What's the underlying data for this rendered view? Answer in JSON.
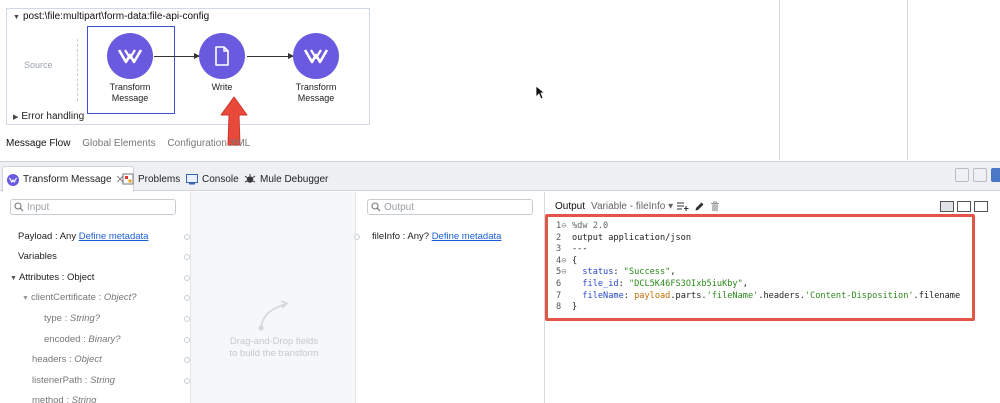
{
  "flow": {
    "title": "post:\\file:multipart\\form-data:file-api-config",
    "source_label": "Source",
    "nodes": [
      {
        "label_line1": "Transform",
        "label_line2": "Message",
        "icon": "mule-transform-icon"
      },
      {
        "label_line1": "Write",
        "label_line2": "",
        "icon": "file-icon"
      },
      {
        "label_line1": "Transform",
        "label_line2": "Message",
        "icon": "mule-transform-icon"
      }
    ],
    "error_handling": "Error handling",
    "node_color": "#6a5ae0"
  },
  "canvas_tabs": [
    "Message Flow",
    "Global Elements",
    "Configuration XML"
  ],
  "bottom_tabs": [
    {
      "label": "Transform Message",
      "icon": "transform-message-icon",
      "active": true
    },
    {
      "label": "Problems",
      "icon": "problems-icon",
      "active": false
    },
    {
      "label": "Console",
      "icon": "console-icon",
      "active": false
    },
    {
      "label": "Mule Debugger",
      "icon": "debugger-icon",
      "active": false
    }
  ],
  "input_panel": {
    "search_placeholder": "Input",
    "payload_prefix": "Payload : Any ",
    "define_metadata": "Define metadata",
    "variables": "Variables",
    "attributes": "Attributes : Object",
    "client_certificate": "clientCertificate : ",
    "client_certificate_type": "Object?",
    "type_prefix": "type : ",
    "type_type": "String?",
    "encoded_prefix": "encoded : ",
    "encoded_type": "Binary?",
    "headers_prefix": "headers : ",
    "headers_type": "Object",
    "listener_prefix": "listenerPath : ",
    "listener_type": "String",
    "method_prefix": "method : ",
    "method_type": "String"
  },
  "mapping": {
    "hint_line1": "Drag-and-Drop fields",
    "hint_line2": "to build the transform"
  },
  "output_panel": {
    "search_placeholder": "Output",
    "fileinfo_prefix": "fileInfo : Any? ",
    "define_metadata": "Define metadata",
    "label": "Output",
    "variable_selector": "Variable - fileInfo"
  },
  "code": {
    "line1": "%dw 2.0",
    "line2": "output application/json",
    "line3": "---",
    "line4": "{",
    "status_key": "status",
    "status_val": "\"Success\"",
    "file_id_key": "file_id",
    "file_id_val": "\"DCL5K46FS3OIxb5iuKby\"",
    "filename_key": "fileName",
    "filename_fn": "payload",
    "filename_rest": ".parts.",
    "filename_str1": "'fileName'",
    "filename_mid": ".headers.",
    "filename_str2": "'Content-Disposition'",
    "filename_end": ".filename",
    "line8": "}"
  },
  "colors": {
    "highlight": "#e25646",
    "link": "#1a5fd6"
  }
}
